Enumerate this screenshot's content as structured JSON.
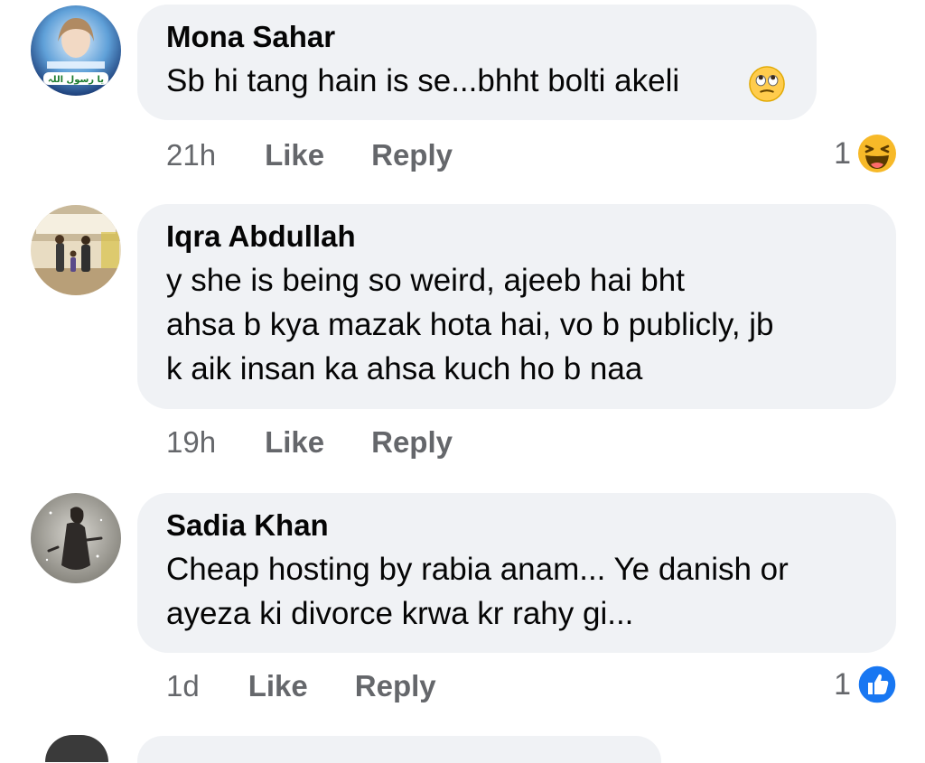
{
  "comments": [
    {
      "author": "Mona Sahar",
      "lines": [
        "Sb hi tang hain is se...bhht bolti akeli"
      ],
      "inline_emoji": "eye-roll-emoji",
      "time": "21h",
      "like_label": "Like",
      "reply_label": "Reply",
      "reaction_count": "1",
      "reaction_icon": "haha-reaction-icon"
    },
    {
      "author": "Iqra Abdullah",
      "lines": [
        "y she is being so weird, ajeeb hai bht",
        "ahsa b kya mazak hota hai, vo b publicly, jb",
        "k aik insan ka ahsa kuch ho b naa"
      ],
      "time": "19h",
      "like_label": "Like",
      "reply_label": "Reply"
    },
    {
      "author": "Sadia Khan",
      "lines": [
        "Cheap hosting by rabia anam... Ye danish or",
        "ayeza ki divorce krwa kr rahy gi..."
      ],
      "time": "1d",
      "like_label": "Like",
      "reply_label": "Reply",
      "reaction_count": "1",
      "reaction_icon": "like-reaction-icon"
    }
  ],
  "colors": {
    "bubble_bg": "#f0f2f5",
    "secondary_text": "#65676b",
    "like_blue": "#1877f2",
    "haha_yellow": "#f7b928"
  },
  "avatar_badges": {
    "mona_avatar_text": "یا رسول اللہ"
  }
}
